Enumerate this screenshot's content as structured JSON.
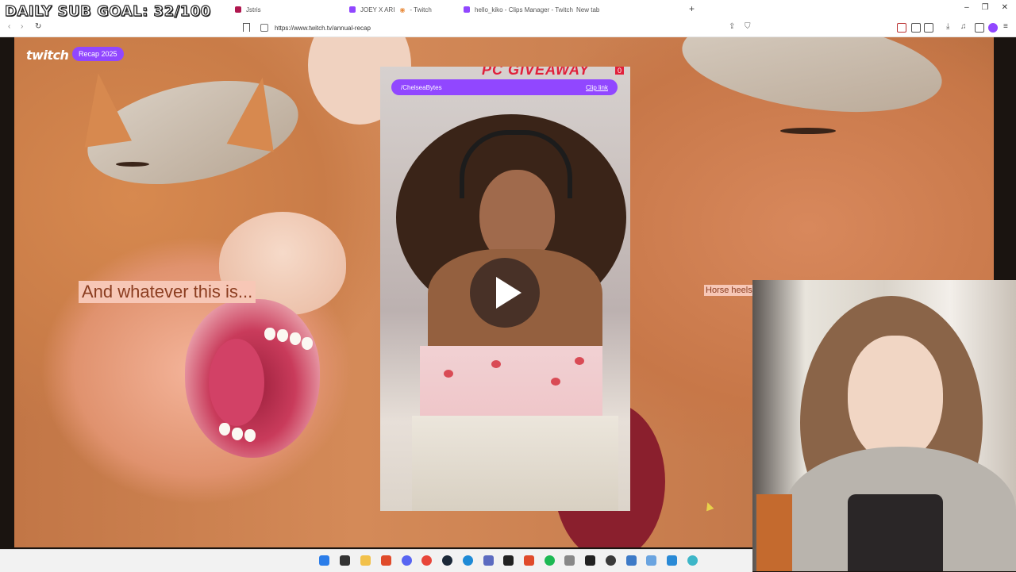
{
  "stream_overlay": {
    "sub_goal_text": "DAILY SUB GOAL: 32/100"
  },
  "browser": {
    "tabs": [
      {
        "label": "",
        "icon": "youtube-icon",
        "color": "#e62e2e"
      },
      {
        "label": "Jstris",
        "icon": "jstris-icon",
        "color": "#b0174f"
      },
      {
        "label": "JOEY X ARI",
        "icon": "twitch-icon",
        "color": "#9147ff"
      },
      {
        "label": "hello_kiko - Clips Manager - Twitch",
        "icon": "twitch-icon",
        "color": "#9147ff"
      },
      {
        "label": "New tab",
        "icon": "newtab-icon",
        "color": "#ffffff"
      }
    ],
    "url": "https://www.twitch.tv/annual-recap"
  },
  "page": {
    "logo": "twitch",
    "recap_badge": "Recap 2025",
    "left_caption": "And whatever this is...",
    "right_caption": "Horse heels",
    "clip": {
      "channel": "/ChelseaBytes",
      "clip_link": "Clip link",
      "banner_text": "PC GIVEAWAY",
      "badge_count": "0"
    }
  },
  "colors": {
    "twitch_purple": "#9147ff",
    "caption_bg": "#f7c7b6",
    "caption_text": "#8b3d20"
  },
  "taskbar": {
    "icons": [
      "windows-start-icon",
      "task-view-icon",
      "file-explorer-icon",
      "brave-icon",
      "discord-icon",
      "chrome-icon",
      "steam-icon",
      "edge-icon",
      "app-icon",
      "terminal-icon",
      "brave-icon",
      "spotify-icon",
      "app-icon",
      "terminal-icon",
      "obs-icon",
      "calculator-icon",
      "notepad-icon",
      "paint-icon",
      "app-icon"
    ]
  }
}
